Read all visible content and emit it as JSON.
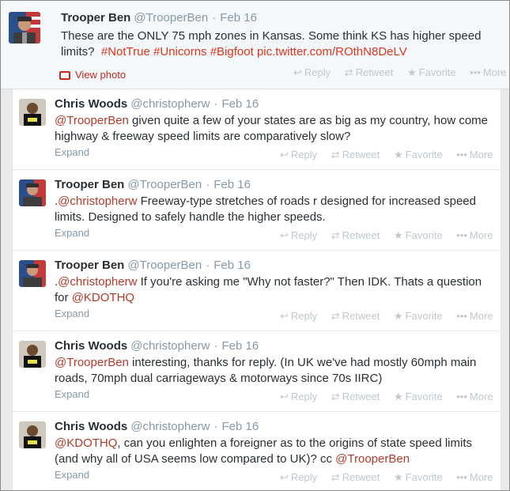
{
  "main": {
    "name": "Trooper Ben",
    "handle": "@TrooperBen",
    "time": "Feb 16",
    "text": "These are the ONLY 75 mph zones in Kansas.  Some think KS has higher speed limits?",
    "hashtags": [
      "#NotTrue",
      "#Unicorns",
      "#Bigfoot"
    ],
    "link": "pic.twitter.com/ROthN8DeLV",
    "view_photo": "View photo"
  },
  "actions": {
    "reply": "Reply",
    "retweet": "Retweet",
    "favorite": "Favorite",
    "more": "More"
  },
  "expand_label": "Expand",
  "replies": [
    {
      "name": "Chris Woods",
      "handle": "@christopherw",
      "time": "Feb 16",
      "mention": "@TrooperBen",
      "text": " given quite a few of your states are as big as my country, how come highway & freeway speed limits are comparatively slow?"
    },
    {
      "name": "Trooper Ben",
      "handle": "@TrooperBen",
      "time": "Feb 16",
      "prefix": ".",
      "mention": "@christopherw",
      "text": " Freeway-type stretches of roads r designed for increased speed limits. Designed to safely handle the higher speeds."
    },
    {
      "name": "Trooper Ben",
      "handle": "@TrooperBen",
      "time": "Feb 16",
      "prefix": ".",
      "mention": "@christopherw",
      "text": " If you're asking me \"Why not faster?\"  Then IDK.  Thats a question for ",
      "mention_end": "@KDOTHQ"
    },
    {
      "name": "Chris Woods",
      "handle": "@christopherw",
      "time": "Feb 16",
      "mention": "@TrooperBen",
      "text": " interesting, thanks for reply. (In UK we've had mostly 60mph main roads, 70mph dual carriageways & motorways since 70s IIRC)"
    },
    {
      "name": "Chris Woods",
      "handle": "@christopherw",
      "time": "Feb 16",
      "mention": "@KDOTHQ",
      "text": ", can you enlighten a foreigner as to the origins of state speed limits (and why all of USA seems low compared to UK)? cc ",
      "mention_end": "@TrooperBen"
    }
  ]
}
